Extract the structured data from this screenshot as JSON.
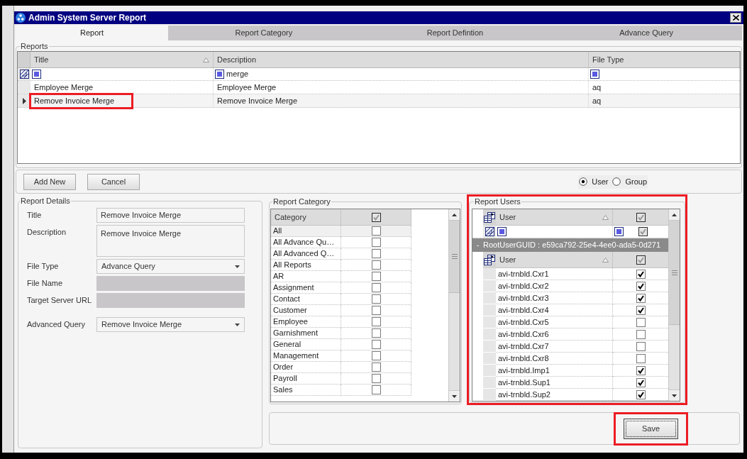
{
  "window": {
    "title": "Admin System Server Report"
  },
  "tabs": [
    {
      "label": "Report",
      "selected": true
    },
    {
      "label": "Report Category",
      "selected": false
    },
    {
      "label": "Report Defintion",
      "selected": false
    },
    {
      "label": "Advance Query",
      "selected": false
    }
  ],
  "reports": {
    "legend": "Reports",
    "columns": [
      {
        "label": "Title",
        "sorted": true
      },
      {
        "label": "Description",
        "sorted": false,
        "filter": "merge"
      },
      {
        "label": "File Type",
        "sorted": false
      }
    ],
    "rows": [
      {
        "cells": [
          "Employee Merge",
          "Employee Merge",
          "aq"
        ],
        "selected": false,
        "title_highlighted": false
      },
      {
        "cells": [
          "Remove Invoice Merge",
          "Remove Invoice Merge",
          "aq"
        ],
        "selected": true,
        "title_highlighted": true
      }
    ]
  },
  "actions": {
    "buttons": [
      "Add New",
      "Cancel"
    ],
    "mode_options": [
      {
        "label": "User",
        "selected": true
      },
      {
        "label": "Group",
        "selected": false
      }
    ]
  },
  "report_details": {
    "legend": "Report Details",
    "fields": [
      {
        "label": "Title",
        "kind": "text",
        "value": "Remove Invoice Merge",
        "disabled": false
      },
      {
        "label": "Description",
        "kind": "textarea",
        "value": "Remove Invoice Merge",
        "disabled": false
      },
      {
        "label": "File Type",
        "kind": "select",
        "value": "Advance Query",
        "disabled": false
      },
      {
        "label": "File Name",
        "kind": "text",
        "disabled": true
      },
      {
        "label": "Target Server URL",
        "kind": "text",
        "disabled": true
      },
      {
        "label": "Advanced Query",
        "kind": "select",
        "value": "Remove Invoice Merge",
        "disabled": false
      }
    ]
  },
  "report_category": {
    "legend": "Report Category",
    "column": "Category",
    "header_checked": true,
    "rows": [
      {
        "name": "All",
        "checked": false,
        "selected": true
      },
      {
        "name": "All Advance Qu…",
        "checked": false,
        "selected": false
      },
      {
        "name": "All Advanced Q…",
        "checked": false,
        "selected": false
      },
      {
        "name": "All Reports",
        "checked": false,
        "selected": false
      },
      {
        "name": "AR",
        "checked": false,
        "selected": false
      },
      {
        "name": "Assignment",
        "checked": false,
        "selected": false
      },
      {
        "name": "Contact",
        "checked": false,
        "selected": false
      },
      {
        "name": "Customer",
        "checked": false,
        "selected": false
      },
      {
        "name": "Employee",
        "checked": false,
        "selected": false
      },
      {
        "name": "Garnishment",
        "checked": false,
        "selected": false
      },
      {
        "name": "General",
        "checked": false,
        "selected": false
      },
      {
        "name": "Management",
        "checked": false,
        "selected": false
      },
      {
        "name": "Order",
        "checked": false,
        "selected": false
      },
      {
        "name": "Payroll",
        "checked": false,
        "selected": false
      },
      {
        "name": "Sales",
        "checked": false,
        "selected": false
      }
    ]
  },
  "report_users": {
    "legend": "Report Users",
    "highlighted": true,
    "column": "User",
    "column_sorted": true,
    "header_checked": true,
    "filter_checked": true,
    "group": {
      "toggle": "-",
      "label": "RootUserGUID : e59ca792-25e4-4ee0-ada5-0d271",
      "column": "User",
      "column_sorted": true,
      "header_checked": true,
      "rows": [
        {
          "name": "avi-trnbld.Cxr1",
          "checked": true
        },
        {
          "name": "avi-trnbld.Cxr2",
          "checked": true
        },
        {
          "name": "avi-trnbld.Cxr3",
          "checked": true
        },
        {
          "name": "avi-trnbld.Cxr4",
          "checked": true
        },
        {
          "name": "avi-trnbld.Cxr5",
          "checked": false
        },
        {
          "name": "avi-trnbld.Cxr6",
          "checked": false
        },
        {
          "name": "avi-trnbld.Cxr7",
          "checked": false
        },
        {
          "name": "avi-trnbld.Cxr8",
          "checked": false
        },
        {
          "name": "avi-trnbld.Imp1",
          "checked": true
        },
        {
          "name": "avi-trnbld.Sup1",
          "checked": true
        },
        {
          "name": "avi-trnbld.Sup2",
          "checked": true
        }
      ]
    }
  },
  "save_button": {
    "label": "Save",
    "focused": true,
    "highlighted": true
  }
}
